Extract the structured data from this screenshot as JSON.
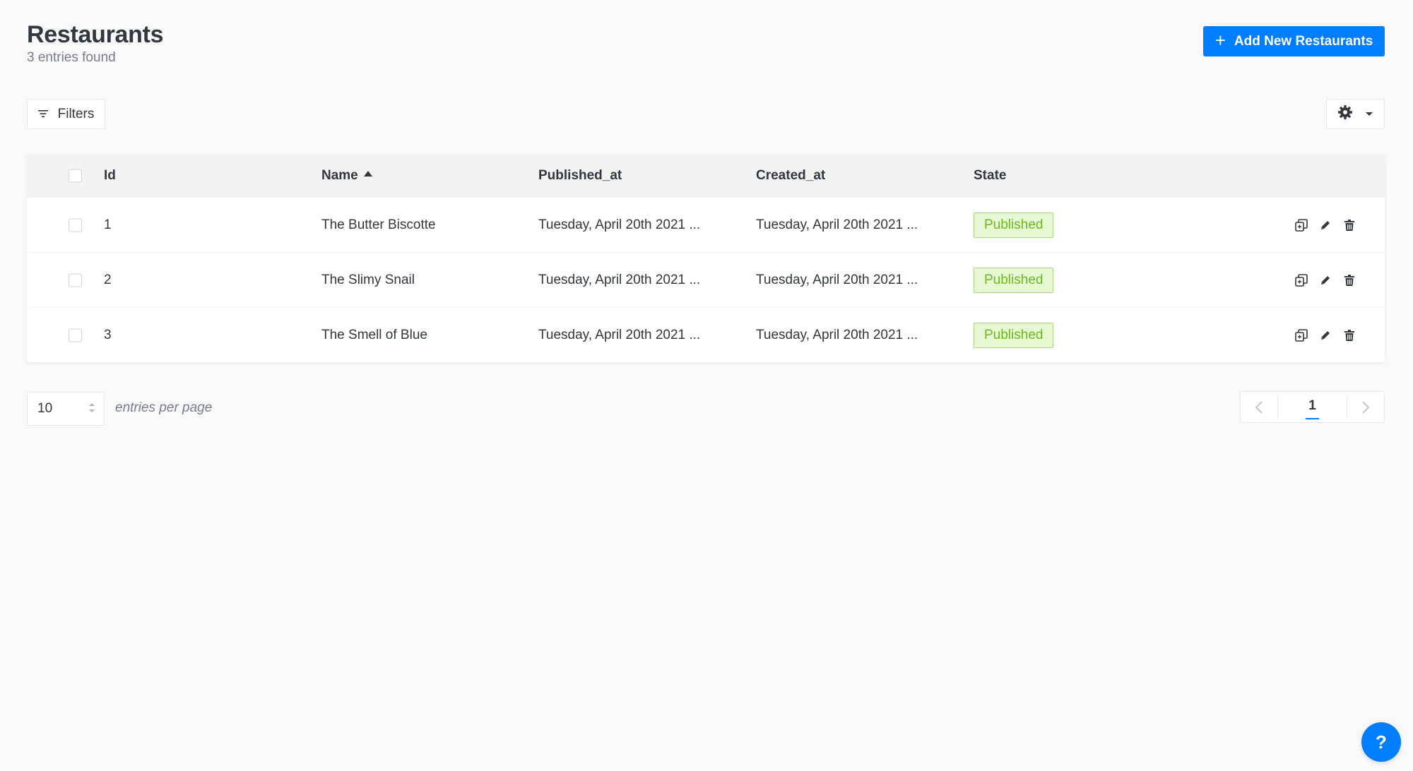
{
  "header": {
    "title": "Restaurants",
    "subtitle": "3 entries found"
  },
  "actions": {
    "add_label": "Add New Restaurants",
    "filters_label": "Filters"
  },
  "table": {
    "columns": {
      "id": "Id",
      "name": "Name",
      "published_at": "Published_at",
      "created_at": "Created_at",
      "state": "State"
    },
    "rows": [
      {
        "id": "1",
        "name": "The Butter Biscotte",
        "published_at": "Tuesday, April 20th 2021 ...",
        "created_at": "Tuesday, April 20th 2021 ...",
        "state": "Published"
      },
      {
        "id": "2",
        "name": "The Slimy Snail",
        "published_at": "Tuesday, April 20th 2021 ...",
        "created_at": "Tuesday, April 20th 2021 ...",
        "state": "Published"
      },
      {
        "id": "3",
        "name": "The Smell of Blue",
        "published_at": "Tuesday, April 20th 2021 ...",
        "created_at": "Tuesday, April 20th 2021 ...",
        "state": "Published"
      }
    ]
  },
  "footer": {
    "per_page_value": "10",
    "per_page_label": "entries per page",
    "current_page": "1"
  },
  "help": {
    "label": "?"
  },
  "colors": {
    "accent": "#007eff",
    "published_bg": "#e6f8d4",
    "published_border": "#aad67c",
    "published_text": "#6dbb1a"
  },
  "icons": {
    "filter": "filter-icon",
    "settings": "gear-icon",
    "duplicate": "duplicate-icon",
    "edit": "pencil-icon",
    "delete": "trash-icon"
  }
}
